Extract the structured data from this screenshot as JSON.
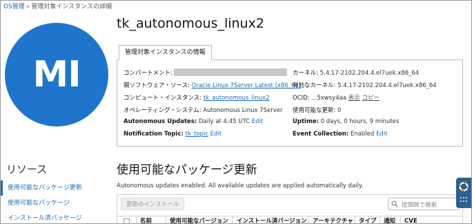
{
  "breadcrumb": {
    "root": "OS管理",
    "separator": "»",
    "current": "管理対象インスタンスの詳細"
  },
  "avatar": {
    "initials": "MI",
    "color": "#1f75cb"
  },
  "header": {
    "title": "tk_autonomous_linux2"
  },
  "info_tab": {
    "label": "管理対象インスタンスの情報"
  },
  "info": {
    "compartment_label": "コンパートメント:",
    "software_source_label": "親ソフトウェア・ソース:",
    "software_source_value": "Oracle Linux 7Server Latest (x86_64)",
    "compute_label": "コンピュート・インスタンス:",
    "compute_value": "tk_autonomous_linux2",
    "os_label": "オペレーティング・システム:",
    "os_value": "Autonomous Linux 7Server",
    "au_label": "Autonomous Updates:",
    "au_value": "Daily at 4:45 UTC",
    "au_edit": "Edit",
    "topic_label": "Notification Topic:",
    "topic_value": "tk_topic",
    "topic_edit": "Edit",
    "kernel_label": "カーネル:",
    "kernel_value": "5.4.17-2102.204.4.el7uek.x86_64",
    "active_kernel_label": "有効なカーネル:",
    "active_kernel_value": "5.4.17-2102.204.4.el7uek.x86_64",
    "ocid_label": "OCID:",
    "ocid_value": "...5xwsy4aa",
    "ocid_show": "表示",
    "ocid_copy": "コピー",
    "updates_label": "使用可能な更新:",
    "updates_value": "0",
    "uptime_label": "Uptime:",
    "uptime_value": "0 days, 0 hours, 9 minutes",
    "event_label": "Event Collection:",
    "event_value": "Enabled",
    "event_edit": "Edit"
  },
  "sidebar": {
    "title": "リソース",
    "items": [
      {
        "label": "使用可能なパッケージ更新",
        "active": true
      },
      {
        "label": "使用可能なパッケージ",
        "active": false
      },
      {
        "label": "インストール済パッケージ",
        "active": false
      }
    ]
  },
  "updates_section": {
    "title": "使用可能なパッケージ更新",
    "note": "Autonomous updates enabled. All available updates are applied automatically daily.",
    "install_button": "更新のインストール",
    "search_placeholder": "接頭辞で検索",
    "columns": [
      "名前",
      "使用可能なバージョン",
      "インストール済バージョン",
      "アーキテクチャ",
      "タイプ",
      "通知",
      "CVE"
    ]
  },
  "colors": {
    "link": "#1c6bb3",
    "help_widget": "#2d5f8e"
  }
}
